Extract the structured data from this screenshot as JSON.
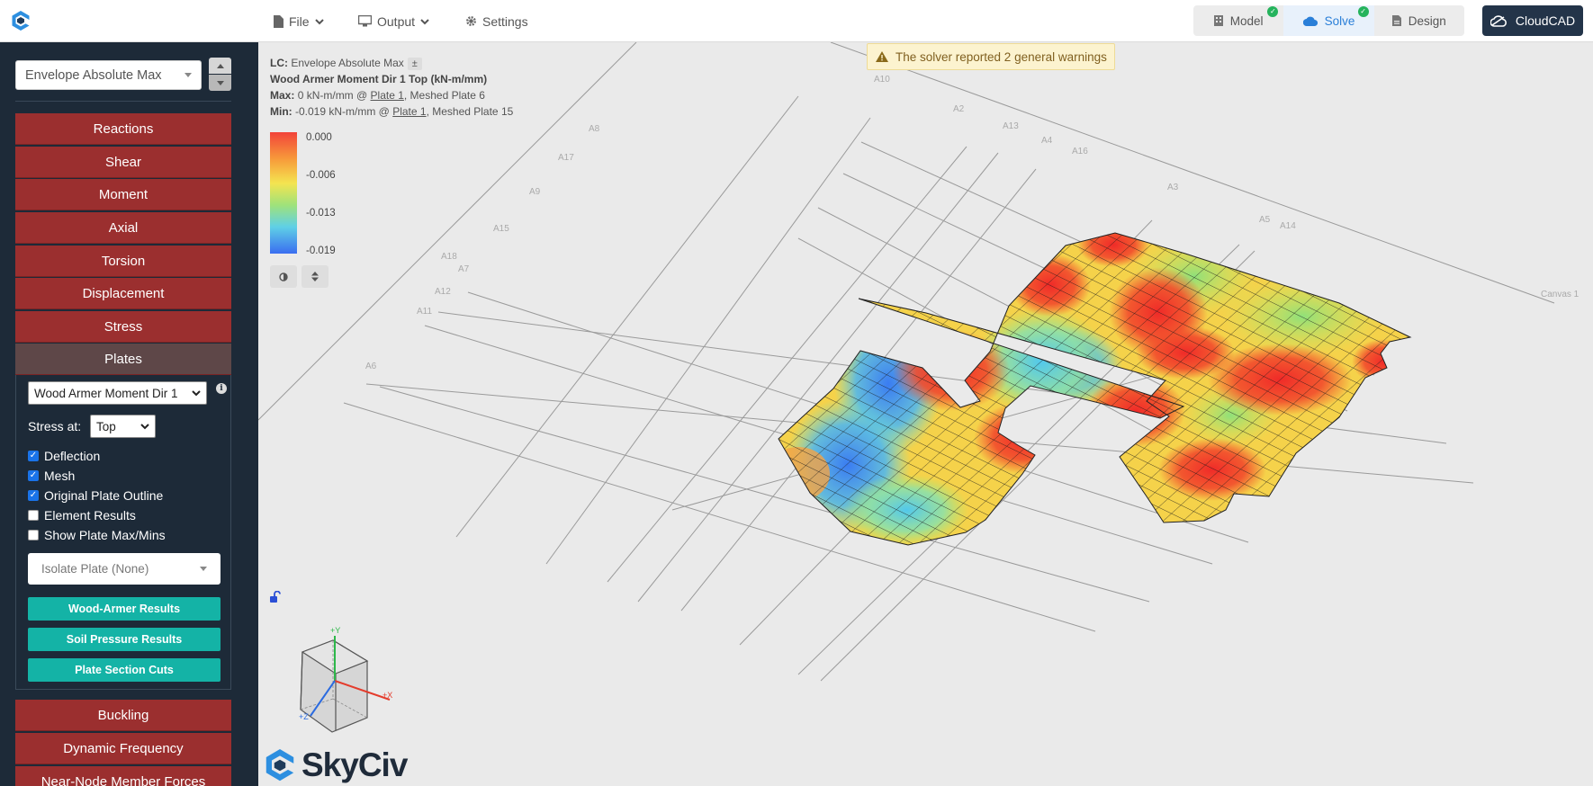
{
  "topbar": {
    "file_label": "File",
    "output_label": "Output",
    "settings_label": "Settings",
    "tabs": [
      {
        "label": "Model",
        "icon": "building-icon",
        "done": true
      },
      {
        "label": "Solve",
        "icon": "cloud-icon",
        "done": true,
        "active": true
      },
      {
        "label": "Design",
        "icon": "document-icon",
        "done": false
      }
    ],
    "cloudcad_label": "CloudCAD"
  },
  "sidebar": {
    "load_case": "Envelope Absolute Max",
    "results": [
      "Reactions",
      "Shear",
      "Moment",
      "Axial",
      "Torsion",
      "Displacement",
      "Stress",
      "Plates"
    ],
    "plates": {
      "result_type": "Wood Armer Moment Dir 1",
      "stress_at_label": "Stress at:",
      "stress_at_value": "Top",
      "options": [
        {
          "label": "Deflection",
          "checked": true
        },
        {
          "label": "Mesh",
          "checked": true
        },
        {
          "label": "Original Plate Outline",
          "checked": true
        },
        {
          "label": "Element Results",
          "checked": false
        },
        {
          "label": "Show Plate Max/Mins",
          "checked": false
        }
      ],
      "isolate_placeholder": "Isolate Plate (None)",
      "buttons": [
        "Wood-Armer Results",
        "Soil Pressure Results",
        "Plate Section Cuts"
      ]
    },
    "more_results": [
      "Buckling",
      "Dynamic Frequency",
      "Near-Node Member Forces"
    ]
  },
  "canvas": {
    "lc_label": "LC:",
    "lc_value": "Envelope Absolute Max",
    "lc_toggle": "±",
    "result_title": "Wood Armer Moment Dir 1 Top (kN-m/mm)",
    "max_label": "Max:",
    "max_value": "0 kN-m/mm @ ",
    "max_plate": "Plate 1",
    "max_mesh": ", Meshed Plate 6",
    "min_label": "Min:",
    "min_value": "-0.019 kN-m/mm @ ",
    "min_plate": "Plate 1",
    "min_mesh": ", Meshed Plate 15",
    "legend_labels": [
      "0.000",
      "-0.006",
      "-0.013",
      "-0.019"
    ],
    "warning": "The solver reported 2 general warnings",
    "axis_labels": [
      "A10",
      "A2",
      "A13",
      "A4",
      "A16",
      "A8",
      "A17",
      "A9",
      "A3",
      "A15",
      "A5",
      "A14",
      "A18",
      "A7",
      "A12",
      "A11",
      "A6"
    ],
    "canvas_tag": "Canvas 1",
    "axes_triad": [
      "+Y",
      "+X",
      "+Z"
    ],
    "brand": "SkyCiv",
    "colors": {
      "header_red": "#9b2f2f",
      "teal": "#14b3a6",
      "sidebar": "#1d2a38",
      "accent_blue": "#2a7fd8"
    }
  }
}
